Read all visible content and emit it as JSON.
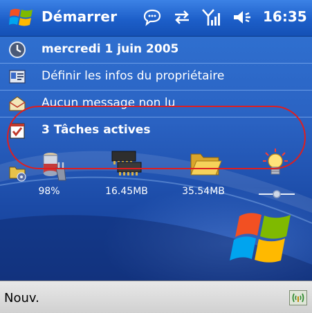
{
  "titlebar": {
    "title": "Démarrer",
    "time": "16:35",
    "icons": [
      "windows-start-icon",
      "notification-icon",
      "connectivity-icon",
      "signal-icon",
      "volume-icon"
    ]
  },
  "today": {
    "date": "mercredi 1 juin 2005",
    "owner": "Définir les infos du propriétaire",
    "messages": "Aucun message non lu",
    "tasks": "3 Tâches actives"
  },
  "plugins": [
    {
      "name": "battery",
      "icon": "battery-icon",
      "label": "98%"
    },
    {
      "name": "memory",
      "icon": "memory-chip-icon",
      "label": "16.45MB"
    },
    {
      "name": "storage",
      "icon": "folder-icon",
      "label": "35.54MB"
    },
    {
      "name": "brightness",
      "icon": "light-bulb-icon",
      "level": 0.5
    }
  ],
  "bottombar": {
    "left_softkey": "Nouv.",
    "right_icon": "wireless-icon"
  },
  "colors": {
    "titlebar": "#1d5fc9",
    "background": "#2a62c2",
    "highlight_oval": "#e01e1e",
    "softbar": "#d8d8d8"
  }
}
